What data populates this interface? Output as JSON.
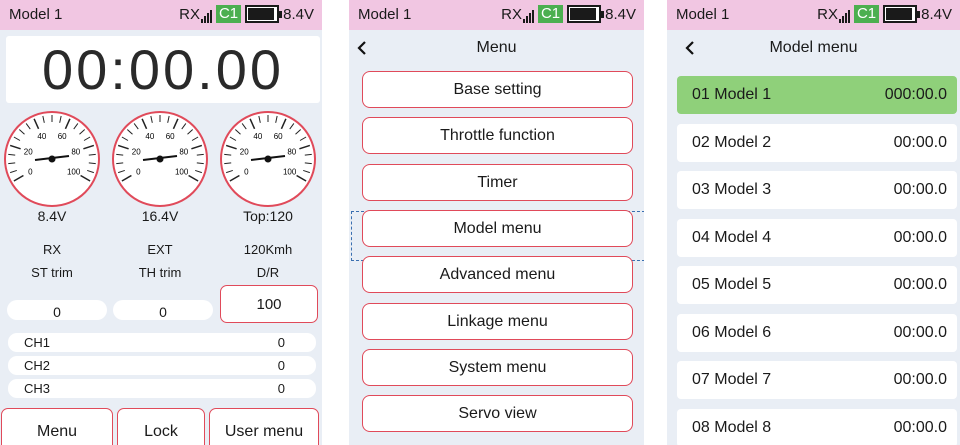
{
  "status": {
    "model": "Model 1",
    "rx": "RX",
    "channel": "C1",
    "voltage": "8.4V",
    "battery_level": 0.85
  },
  "dashboard": {
    "timer": "00:00.00",
    "gauge_ticks": [
      "0",
      "20",
      "40",
      "60",
      "80",
      "100"
    ],
    "gauges": [
      {
        "value": "8.4V",
        "label": "RX"
      },
      {
        "value": "16.4V",
        "label": "EXT"
      },
      {
        "value": "Top:120",
        "label": "120Kmh"
      }
    ],
    "trims": [
      {
        "label": "ST trim",
        "value": "0"
      },
      {
        "label": "TH trim",
        "value": "0"
      },
      {
        "label": "D/R",
        "value": "100"
      }
    ],
    "channels": [
      {
        "name": "CH1",
        "value": "0"
      },
      {
        "name": "CH2",
        "value": "0"
      },
      {
        "name": "CH3",
        "value": "0"
      }
    ],
    "buttons": {
      "menu": "Menu",
      "lock": "Lock",
      "user_menu": "User menu"
    }
  },
  "menu": {
    "title": "Menu",
    "items": [
      "Base setting",
      "Throttle function",
      "Timer",
      "Model menu",
      "Advanced menu",
      "Linkage menu",
      "System menu",
      "Servo view"
    ],
    "focused_index": 3
  },
  "model_menu": {
    "title": "Model menu",
    "models": [
      {
        "name": "01 Model 1",
        "time": "000:00.0"
      },
      {
        "name": "02 Model 2",
        "time": "00:00.0"
      },
      {
        "name": "03 Model 3",
        "time": "00:00.0"
      },
      {
        "name": "04 Model 4",
        "time": "00:00.0"
      },
      {
        "name": "05 Model 5",
        "time": "00:00.0"
      },
      {
        "name": "06 Model 6",
        "time": "00:00.0"
      },
      {
        "name": "07 Model 7",
        "time": "00:00.0"
      },
      {
        "name": "08 Model 8",
        "time": "00:00.0"
      }
    ],
    "selected_index": 0
  },
  "colors": {
    "status_bar": "#f1c6e2",
    "screen_bg": "#e9eef5",
    "accent_border": "#e04a5a",
    "channel_badge": "#4caf50",
    "selected_row": "#8fd07a",
    "focus_outline": "#3a6fb0"
  }
}
